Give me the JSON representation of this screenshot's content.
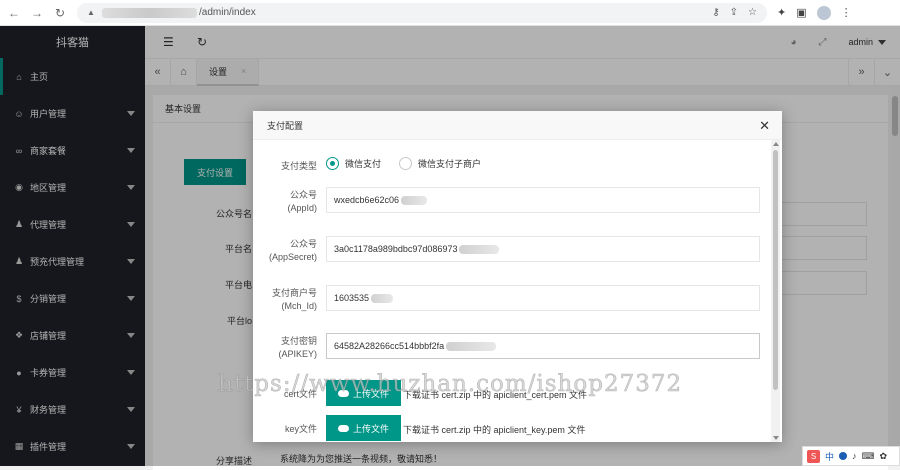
{
  "browser": {
    "url_path": "/admin/index"
  },
  "sidebar": {
    "brand": "抖客猫",
    "items": [
      {
        "label": "主页",
        "icon": "home-icon",
        "glyph": "⌂"
      },
      {
        "label": "用户管理",
        "icon": "user-icon",
        "glyph": "☺"
      },
      {
        "label": "商家套餐",
        "icon": "link-icon",
        "glyph": "∞"
      },
      {
        "label": "地区管理",
        "icon": "region-icon",
        "glyph": "◉"
      },
      {
        "label": "代理管理",
        "icon": "agent-icon",
        "glyph": "♟"
      },
      {
        "label": "预充代理管理",
        "icon": "agent-prepaid-icon",
        "glyph": "♟"
      },
      {
        "label": "分销管理",
        "icon": "distribution-icon",
        "glyph": "$"
      },
      {
        "label": "店铺管理",
        "icon": "shop-icon",
        "glyph": "❖"
      },
      {
        "label": "卡券管理",
        "icon": "coupon-icon",
        "glyph": "●"
      },
      {
        "label": "财务管理",
        "icon": "finance-icon",
        "glyph": "¥"
      },
      {
        "label": "插件管理",
        "icon": "plugin-icon",
        "glyph": "▦"
      }
    ]
  },
  "topbar": {
    "user": "admin"
  },
  "tabs": {
    "active": "设置"
  },
  "page": {
    "card_title": "基本设置",
    "pay_settings_button": "支付设置",
    "labels": [
      "公众号名",
      "平台名",
      "平台电",
      "平台lo"
    ],
    "share_desc_label": "分享描述",
    "share_desc_value": "系统降为为您推送一条视频，敬请知悉！"
  },
  "modal": {
    "title": "支付配置",
    "pay_type_label": "支付类型",
    "pay_type_options": [
      "微信支付",
      "微信支付子商户"
    ],
    "pay_type_selected": "微信支付",
    "fields": [
      {
        "label": "公众号",
        "sub": "(AppId)",
        "value": "wxedcb6e62c06"
      },
      {
        "label": "公众号",
        "sub": "(AppSecret)",
        "value": "3a0c1178a989bdbc97d086973"
      },
      {
        "label": "支付商户号",
        "sub": "(Mch_Id)",
        "value": "1603535"
      },
      {
        "label": "支付密钥",
        "sub": "(APIKEY)",
        "value": "64582A28266cc514bbbf2fa"
      }
    ],
    "cert_label": "cert文件",
    "cert_hint": "下载证书 cert.zip 中的 apiclient_cert.pem 文件",
    "key_label": "key文件",
    "key_hint": "下载证书 cert.zip 中的 apiclient_key.pem 文件",
    "upload_label": "上传文件"
  },
  "watermark": "https://www.huzhan.com/ishop27372",
  "ime": {
    "mode": "中"
  }
}
